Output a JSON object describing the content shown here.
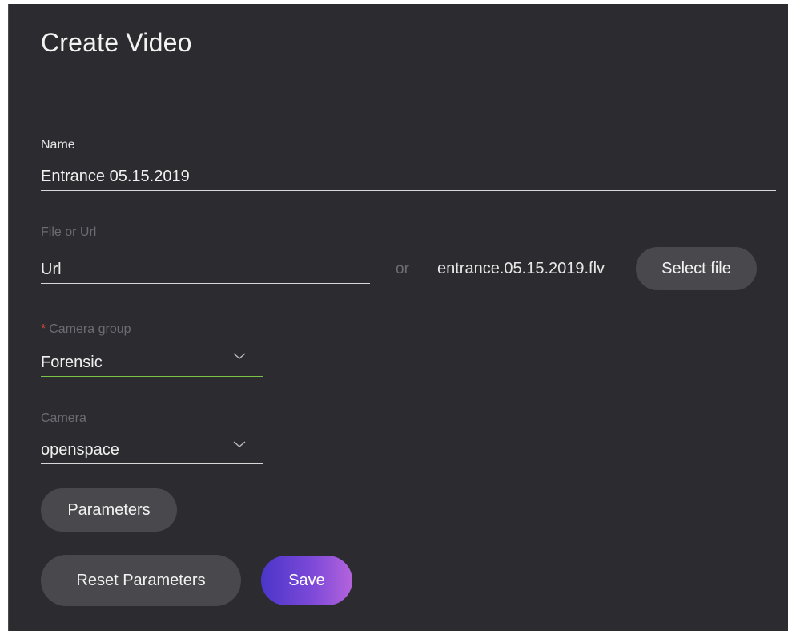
{
  "dialog": {
    "title": "Create Video"
  },
  "name_field": {
    "label": "Name",
    "value": "Entrance 05.15.2019"
  },
  "source": {
    "label": "File or Url",
    "url_value": "Url",
    "or_text": "or",
    "file_name": "entrance.05.15.2019.flv",
    "select_file_label": "Select file"
  },
  "camera_group": {
    "required_mark": "*",
    "label": "Camera group",
    "value": "Forensic"
  },
  "camera": {
    "label": "Camera",
    "value": "openspace"
  },
  "actions": {
    "parameters_label": "Parameters",
    "reset_label": "Reset Parameters",
    "save_label": "Save"
  },
  "icons": {
    "dropdown": "chevron-down-icon"
  },
  "colors": {
    "panel_bg": "#2c2c30",
    "button_bg": "#48484d",
    "focus_underline": "#7cc244",
    "required": "#e2493a",
    "save_gradient_start": "#4a36c9",
    "save_gradient_end": "#b463dc"
  }
}
